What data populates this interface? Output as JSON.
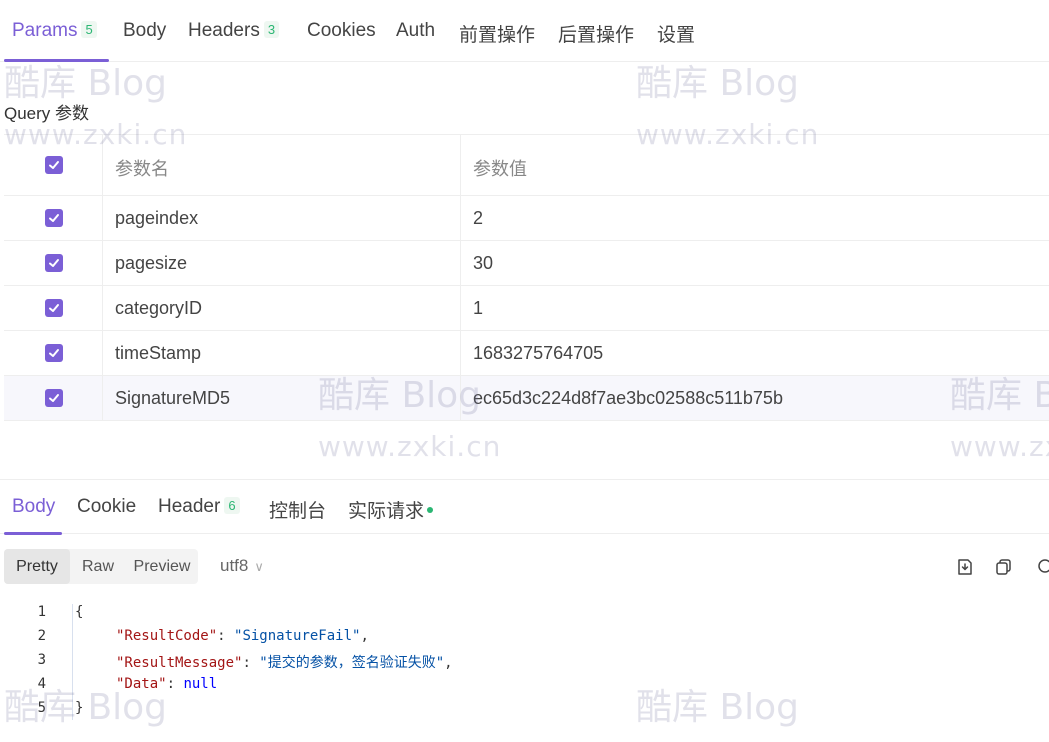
{
  "request_tabs": [
    {
      "label": "Params",
      "count": "5",
      "active": true
    },
    {
      "label": "Body"
    },
    {
      "label": "Headers",
      "count": "3"
    },
    {
      "label": "Cookies"
    },
    {
      "label": "Auth"
    },
    {
      "label": "前置操作"
    },
    {
      "label": "后置操作"
    },
    {
      "label": "设置"
    }
  ],
  "query_label": "Query 参数",
  "params_table": {
    "header": {
      "name": "参数名",
      "value": "参数值"
    },
    "rows": [
      {
        "name": "pageindex",
        "value": "2",
        "checked": true
      },
      {
        "name": "pagesize",
        "value": "30",
        "checked": true
      },
      {
        "name": "categoryID",
        "value": "1",
        "checked": true
      },
      {
        "name": "timeStamp",
        "value": "1683275764705",
        "checked": true
      },
      {
        "name": "SignatureMD5",
        "value": "ec65d3c224d8f7ae3bc02588c511b75b",
        "checked": true
      }
    ]
  },
  "response_tabs": [
    {
      "label": "Body",
      "active": true
    },
    {
      "label": "Cookie"
    },
    {
      "label": "Header",
      "count": "6"
    },
    {
      "label": "控制台"
    },
    {
      "label": "实际请求"
    }
  ],
  "view_modes": [
    "Pretty",
    "Raw",
    "Preview"
  ],
  "encoding": "utf8",
  "code": {
    "line_numbers": [
      "1",
      "2",
      "3",
      "4",
      "5"
    ],
    "open_brace": "{",
    "close_brace": "}",
    "entries": [
      {
        "key": "\"ResultCode\"",
        "value": "\"SignatureFail\"",
        "sep": ": ",
        "end": ","
      },
      {
        "key": "\"ResultMessage\"",
        "value": "\"提交的参数，签名验证失败\"",
        "sep": ": ",
        "end": ","
      },
      {
        "key": "\"Data\"",
        "value": "null",
        "sep": ": ",
        "end": ""
      }
    ]
  },
  "watermark": {
    "brand": "酷库 Blog",
    "url": "www.zxki.cn"
  },
  "colors": {
    "accent": "#7b5fd6",
    "count_badge": "#2bb673",
    "json_key": "#a31515",
    "json_string": "#0451a5",
    "json_null": "#0000ff"
  }
}
